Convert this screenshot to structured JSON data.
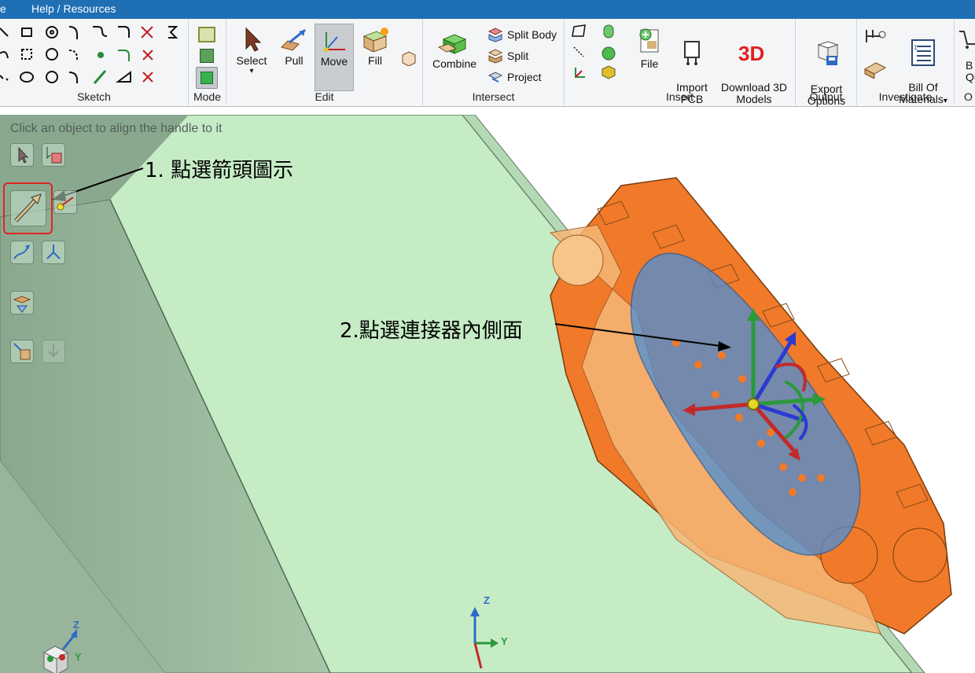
{
  "menubar": {
    "file_fragment": "e",
    "help": "Help / Resources"
  },
  "ribbon": {
    "groups": {
      "sketch": "Sketch",
      "mode": "Mode",
      "edit": "Edit",
      "intersect": "Intersect",
      "insert": "Insert",
      "output": "Output",
      "investigate": "Investigate",
      "partial": "O"
    },
    "edit": {
      "select": "Select",
      "pull": "Pull",
      "move": "Move",
      "fill": "Fill"
    },
    "intersect": {
      "combine": "Combine",
      "split_body": "Split Body",
      "split": "Split",
      "project": "Project"
    },
    "insert": {
      "file": "File",
      "import_pcb": "Import\nPCB",
      "download_3d": "Download 3D\nModels"
    },
    "output": {
      "export_options": "Export\nOptions"
    },
    "investigate": {
      "bill_of_materials": "Bill Of\nMaterials",
      "partial_q": "B\nQu"
    }
  },
  "viewport": {
    "hint": "Click an object to align the handle to it",
    "callout_1": "1. 點選箭頭圖示",
    "callout_2": "2.點選連接器內側面",
    "axis_labels": {
      "z": "Z",
      "y": "Y"
    }
  },
  "colors": {
    "accent": "#1f6fb5",
    "highlight_box": "#e02424",
    "plane_green": "#c6ecc6",
    "part_orange": "#f07a2a",
    "selection_blue": "#4b8fd6"
  }
}
